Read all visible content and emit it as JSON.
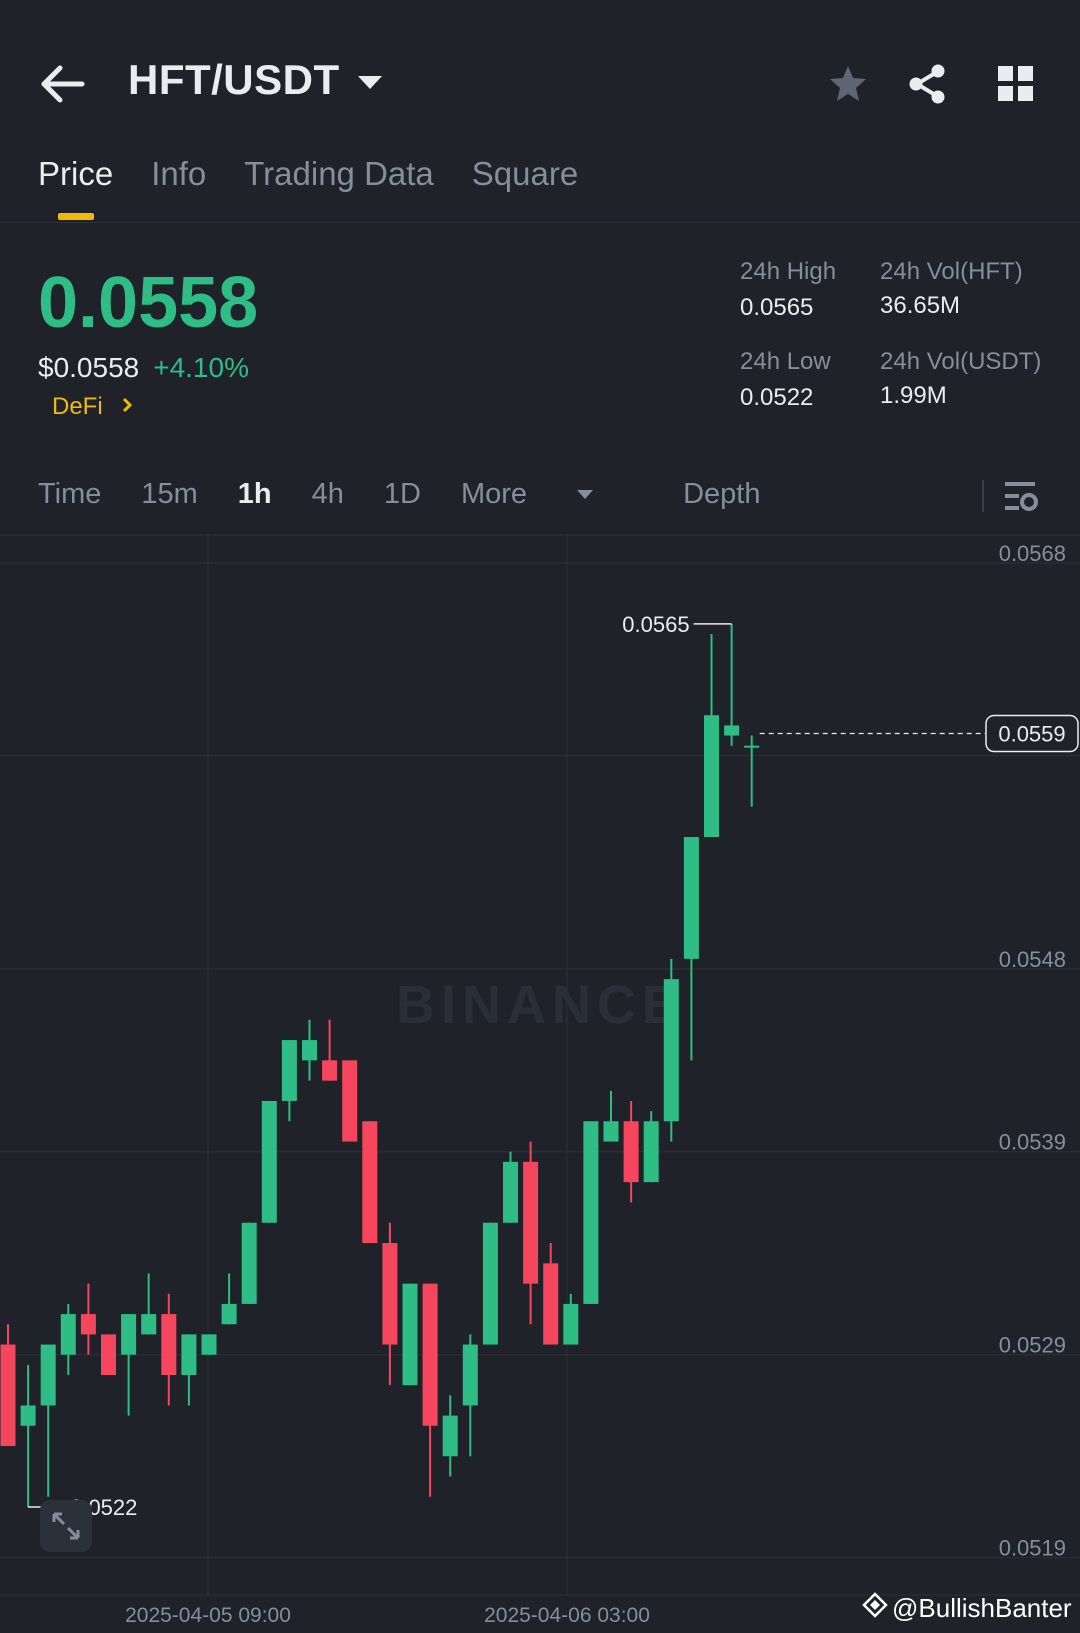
{
  "header": {
    "pair": "HFT/USDT",
    "icons": [
      "back-arrow-icon",
      "star-icon",
      "share-icon",
      "grid-icon"
    ]
  },
  "tabs": [
    {
      "label": "Price",
      "active": true
    },
    {
      "label": "Info"
    },
    {
      "label": "Trading Data"
    },
    {
      "label": "Square"
    }
  ],
  "ticker": {
    "last_price": "0.0558",
    "usd_price": "$0.0558",
    "change": "+4.10%",
    "sector": "DeFi",
    "high_label": "24h High",
    "high_value": "0.0565",
    "low_label": "24h Low",
    "low_value": "0.0522",
    "vol_base_label": "24h Vol(HFT)",
    "vol_base_value": "36.65M",
    "vol_quote_label": "24h Vol(USDT)",
    "vol_quote_value": "1.99M"
  },
  "intervals": {
    "time": "Time",
    "m15": "15m",
    "h1": "1h",
    "h4": "4h",
    "d1": "1D",
    "more": "More",
    "depth": "Depth",
    "active": "1h"
  },
  "colors": {
    "up": "#2ebd85",
    "down": "#f6465d",
    "accent": "#f0b90b",
    "background": "#1f2329",
    "grid": "#2b3139"
  },
  "chart_data": {
    "type": "candlestick",
    "watermark": "BINANCE",
    "y_ticks": [
      0.0568,
      0.0548,
      0.0539,
      0.0529,
      0.0519
    ],
    "y_tick_labels": [
      "0.0568",
      "0.0548",
      "0.0539",
      "0.0529",
      "0.0519"
    ],
    "x_ticks": [
      "2025-04-05 09:00",
      "2025-04-06 03:00"
    ],
    "current_price_label": "0.0559",
    "max_label": "0.0565",
    "min_label": "0.0522",
    "candles": [
      {
        "o": 0.05295,
        "h": 0.05305,
        "c": 0.05245,
        "l": 0.05245
      },
      {
        "o": 0.05255,
        "h": 0.05285,
        "c": 0.05265,
        "l": 0.05215
      },
      {
        "o": 0.05265,
        "h": 0.0529,
        "c": 0.05295,
        "l": 0.0522
      },
      {
        "o": 0.0529,
        "h": 0.05315,
        "c": 0.0531,
        "l": 0.0528
      },
      {
        "o": 0.0531,
        "h": 0.05325,
        "c": 0.053,
        "l": 0.0529
      },
      {
        "o": 0.053,
        "h": 0.053,
        "c": 0.0528,
        "l": 0.0528
      },
      {
        "o": 0.0529,
        "h": 0.0531,
        "c": 0.0531,
        "l": 0.0526
      },
      {
        "o": 0.053,
        "h": 0.0533,
        "c": 0.0531,
        "l": 0.053
      },
      {
        "o": 0.0531,
        "h": 0.0532,
        "c": 0.0528,
        "l": 0.05265
      },
      {
        "o": 0.0528,
        "h": 0.053,
        "c": 0.053,
        "l": 0.05265
      },
      {
        "o": 0.0529,
        "h": 0.053,
        "c": 0.053,
        "l": 0.0529
      },
      {
        "o": 0.05305,
        "h": 0.0533,
        "c": 0.05315,
        "l": 0.05305
      },
      {
        "o": 0.05315,
        "h": 0.05355,
        "c": 0.05355,
        "l": 0.05315
      },
      {
        "o": 0.05355,
        "h": 0.05415,
        "c": 0.05415,
        "l": 0.05355
      },
      {
        "o": 0.05415,
        "h": 0.05435,
        "c": 0.05445,
        "l": 0.05405
      },
      {
        "o": 0.05435,
        "h": 0.05455,
        "c": 0.05445,
        "l": 0.05425
      },
      {
        "o": 0.05435,
        "h": 0.05455,
        "c": 0.05425,
        "l": 0.05425
      },
      {
        "o": 0.05435,
        "h": 0.05435,
        "c": 0.05395,
        "l": 0.05395
      },
      {
        "o": 0.05405,
        "h": 0.05405,
        "c": 0.05345,
        "l": 0.05345
      },
      {
        "o": 0.05345,
        "h": 0.05355,
        "c": 0.05295,
        "l": 0.05275
      },
      {
        "o": 0.05275,
        "h": 0.05325,
        "c": 0.05325,
        "l": 0.05275
      },
      {
        "o": 0.05325,
        "h": 0.05325,
        "c": 0.05255,
        "l": 0.0522
      },
      {
        "o": 0.0524,
        "h": 0.0527,
        "c": 0.0526,
        "l": 0.0523
      },
      {
        "o": 0.05265,
        "h": 0.053,
        "c": 0.05295,
        "l": 0.0524
      },
      {
        "o": 0.05295,
        "h": 0.05355,
        "c": 0.05355,
        "l": 0.05295
      },
      {
        "o": 0.05355,
        "h": 0.0539,
        "c": 0.05385,
        "l": 0.05355
      },
      {
        "o": 0.05385,
        "h": 0.05395,
        "c": 0.05325,
        "l": 0.05305
      },
      {
        "o": 0.05335,
        "h": 0.05345,
        "c": 0.05295,
        "l": 0.05295
      },
      {
        "o": 0.05295,
        "h": 0.0532,
        "c": 0.05315,
        "l": 0.05295
      },
      {
        "o": 0.05315,
        "h": 0.05405,
        "c": 0.05405,
        "l": 0.05315
      },
      {
        "o": 0.05395,
        "h": 0.0542,
        "c": 0.05405,
        "l": 0.05395
      },
      {
        "o": 0.05405,
        "h": 0.05415,
        "c": 0.05375,
        "l": 0.05365
      },
      {
        "o": 0.05375,
        "h": 0.0541,
        "c": 0.05405,
        "l": 0.05375
      },
      {
        "o": 0.05405,
        "h": 0.05485,
        "c": 0.05475,
        "l": 0.05395
      },
      {
        "o": 0.05485,
        "h": 0.05545,
        "c": 0.05545,
        "l": 0.05435
      },
      {
        "o": 0.05545,
        "h": 0.05645,
        "c": 0.05605,
        "l": 0.05545
      },
      {
        "o": 0.05595,
        "h": 0.0565,
        "c": 0.056,
        "l": 0.0559
      },
      {
        "o": 0.0559,
        "h": 0.05595,
        "c": 0.0559,
        "l": 0.0556
      }
    ]
  },
  "footer": {
    "credit": "@BullishBanter"
  }
}
